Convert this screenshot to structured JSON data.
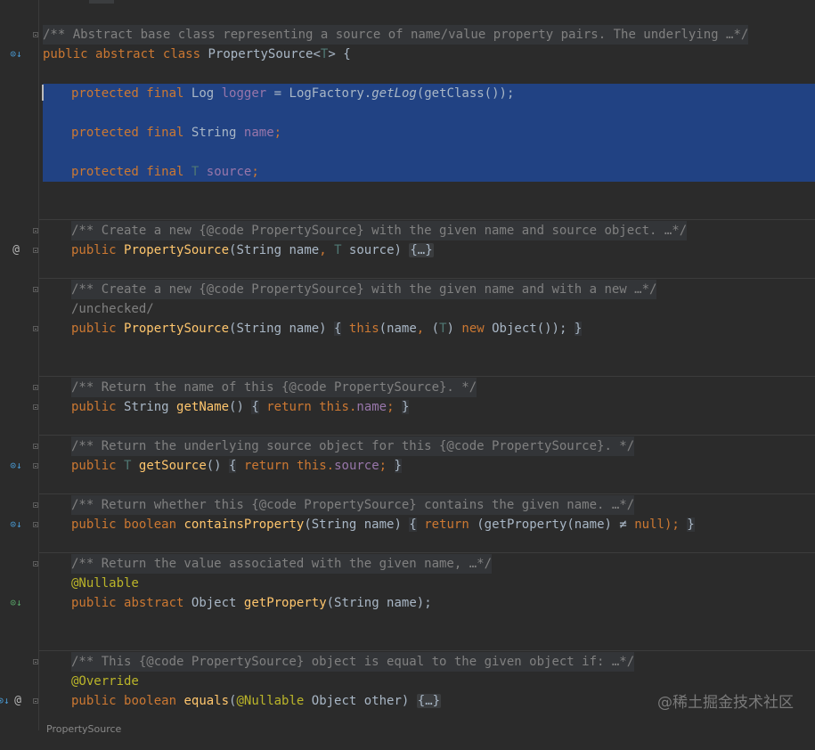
{
  "editor": {
    "gutter_icons": {
      "implemented": "implemented-down-icon",
      "overrides": "overrides-icon",
      "annotation": "at-sign-icon",
      "implemented_glyph": "⊙↓",
      "overrides_glyph": "⊙↓",
      "at_glyph": "@"
    },
    "code": {
      "class_doc": "/** Abstract base class representing a source of name/value property pairs. The underlying …*/",
      "class_decl": {
        "kw_public": "public",
        "kw_abstract": "abstract",
        "kw_class": "class",
        "name": "PropertySource<",
        "tparam": "T",
        "rest": "> {"
      },
      "logger_line": {
        "kw1": "protected",
        "kw2": "final",
        "type": "Log",
        "field": "logger",
        "eq": "=",
        "call_obj": "LogFactory.",
        "call_m": "getLog",
        "call_args": "(getClass());"
      },
      "name_field": {
        "kw1": "protected",
        "kw2": "final",
        "type": "String",
        "field": "name",
        "semi": ";"
      },
      "source_field": {
        "kw1": "protected",
        "kw2": "final",
        "type": "T",
        "field": "source",
        "semi": ";"
      },
      "ctor1_doc": "/** Create a new {@code PropertySource} with the given name and source object. …*/",
      "ctor1": {
        "kw": "public",
        "name": "PropertySource",
        "params_a": "(String name",
        "comma": ",",
        "tp": "T",
        "params_b": " source)",
        "body": "{…}"
      },
      "ctor2_doc": "/** Create a new {@code PropertySource} with the given name and with a new …*/",
      "ctor2_suppress": "/unchecked/",
      "ctor2": {
        "kw": "public",
        "name": "PropertySource",
        "params": "(String name)",
        "ob": "{",
        "this": "this",
        "args_a": "(name",
        "comma": ",",
        "cast_a": " (",
        "tp": "T",
        "cast_b": ") ",
        "new": "new",
        "obj": " Object());",
        "cb": "}"
      },
      "getname_doc": "/** Return the name of this {@code PropertySource}. */",
      "getname": {
        "kw": "public",
        "type": "String",
        "name": "getName",
        "parens": "()",
        "ob": "{",
        "ret": "return",
        "this": "this.",
        "field": "name",
        "semi": ";",
        "cb": "}"
      },
      "getsource_doc": "/** Return the underlying source object for this {@code PropertySource}. */",
      "getsource": {
        "kw": "public",
        "tp": "T",
        "name": "getSource",
        "parens": "()",
        "ob": "{",
        "ret": "return",
        "this": "this.",
        "field": "source",
        "semi": ";",
        "cb": "}"
      },
      "contains_doc": "/** Return whether this {@code PropertySource} contains the given name. …*/",
      "contains": {
        "kw": "public",
        "type": "boolean",
        "name": "containsProperty",
        "params": "(String name)",
        "ob": "{",
        "ret": "return",
        "body": "(getProperty(name) ≠ ",
        "null": "null",
        "tail": ");",
        "cb": "}"
      },
      "getprop_doc": "/** Return the value associated with the given name, …*/",
      "getprop_ann": "@Nullable",
      "getprop": {
        "kw1": "public",
        "kw2": "abstract",
        "type": "Object",
        "name": "getProperty",
        "params": "(String name);"
      },
      "equals_doc": "/** This {@code PropertySource} object is equal to the given object if: …*/",
      "equals_ann": "@Override",
      "equals": {
        "kw": "public",
        "type": "boolean",
        "name": "equals",
        "paren": "(",
        "ann": "@Nullable",
        "params": " Object other)",
        "body": "{…}"
      }
    },
    "footer_crumb": "PropertySource",
    "watermark": "@稀土掘金技术社区"
  }
}
